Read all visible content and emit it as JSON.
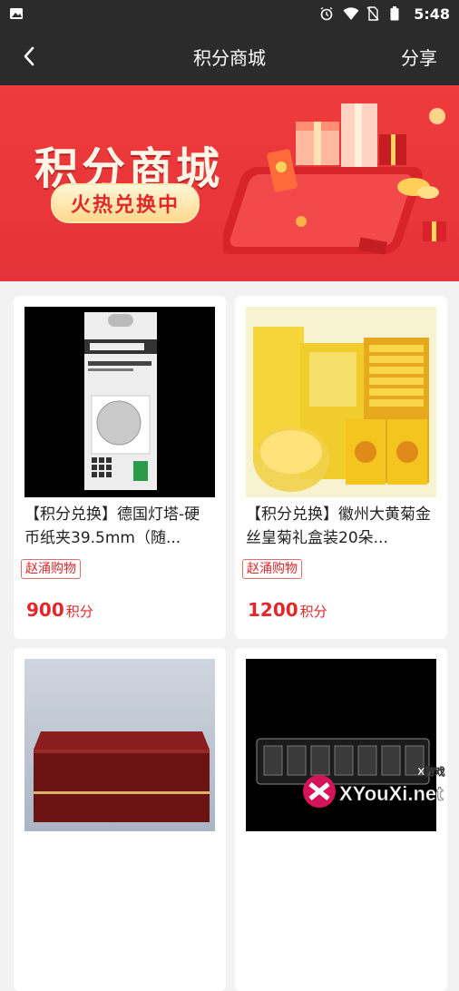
{
  "status_bar": {
    "time": "5:48",
    "icons": [
      "image-icon",
      "alarm-icon",
      "wifi-icon",
      "no-sim-icon",
      "battery-icon"
    ]
  },
  "app_bar": {
    "title": "积分商城",
    "share_label": "分享",
    "back_icon": "back-arrow-icon"
  },
  "banner": {
    "title": "积分商城",
    "subtitle": "火热兑换中"
  },
  "products": [
    {
      "name": "【积分兑换】德国灯塔-硬币纸夹39.5mm（随...",
      "shop": "赵涌购物",
      "points": "900",
      "unit": "积分"
    },
    {
      "name": "【积分兑换】徽州大黄菊金丝皇菊礼盒装20朵...",
      "shop": "赵涌购物",
      "points": "1200",
      "unit": "积分"
    },
    {
      "name": "",
      "shop": "",
      "points": "",
      "unit": ""
    },
    {
      "name": "",
      "shop": "",
      "points": "",
      "unit": ""
    }
  ],
  "watermark": {
    "brand": "XYouXi.net",
    "tag": "X游戏"
  },
  "colors": {
    "accent": "#e0282b",
    "header_bg": "#2b2b2b",
    "banner_bg": "#ef3b3b"
  }
}
